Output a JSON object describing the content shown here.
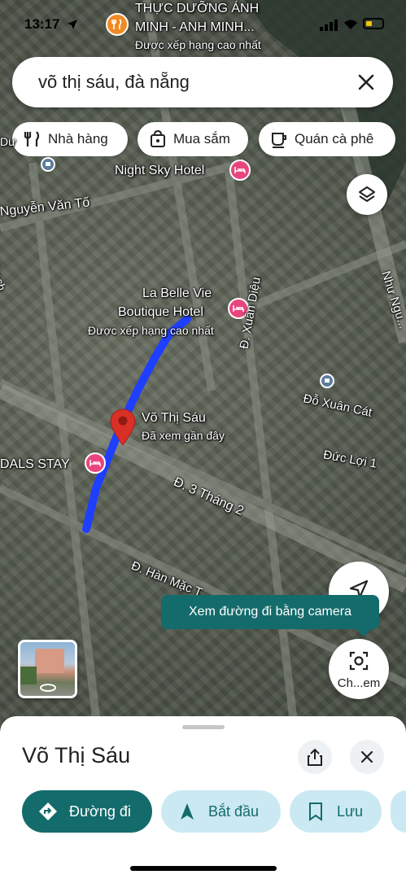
{
  "status_bar": {
    "time": "13:17"
  },
  "search": {
    "query": "võ thị sáu, đà nẵng"
  },
  "chips": [
    {
      "label": "Nhà hàng",
      "icon": "fork-knife-icon"
    },
    {
      "label": "Mua sắm",
      "icon": "shopping-bag-icon"
    },
    {
      "label": "Quán cà phê",
      "icon": "coffee-cup-icon"
    }
  ],
  "map": {
    "top_place": {
      "name_line1": "THỰC DƯỠNG ÁNH",
      "name_line2": "MINH - ANH MINH...",
      "rating_note": "Được xếp hạng cao nhất"
    },
    "hotel1": "Night Sky Hotel",
    "hotel2": {
      "line1": "La Belle Vie",
      "line2": "Boutique Hotel",
      "note": "Được xếp hạng cao nhất"
    },
    "hotel3": "DALS STAY",
    "street_labels": {
      "nguyen_van_to": "Nguyễn Văn Tố",
      "thach": "Thạch",
      "xuan_dieu": "Đ. Xuân Diệu",
      "do_xuan_cat": "Đỗ Xuân Cát",
      "duc_loi": "Đức Lợi 1",
      "ba_thang_hai": "Đ. 3 Tháng 2",
      "han_mac_tu": "Đ. Hàn Mặc T...",
      "nhu_nguyet": "Như Ngu...",
      "du": "Dư"
    },
    "selected_pin": {
      "name": "Võ Thị Sáu",
      "note": "Đã xem gần đây"
    }
  },
  "tooltip": {
    "text": "Xem đường đi bằng camera"
  },
  "camera_button": {
    "label": "Ch...em"
  },
  "sheet": {
    "title": "Võ Thị Sáu",
    "actions": [
      {
        "label": "Đường đi",
        "icon": "directions-icon"
      },
      {
        "label": "Bắt đầu",
        "icon": "navigation-arrow-icon"
      },
      {
        "label": "Lưu",
        "icon": "bookmark-icon"
      }
    ]
  },
  "colors": {
    "route": "#1f3fff",
    "accent_teal": "#146b6b",
    "directions_bg": "#146b6b",
    "secondary_bg": "#cbe9f3",
    "hotel_pin": "#e8457f",
    "pin_red": "#d93025"
  }
}
